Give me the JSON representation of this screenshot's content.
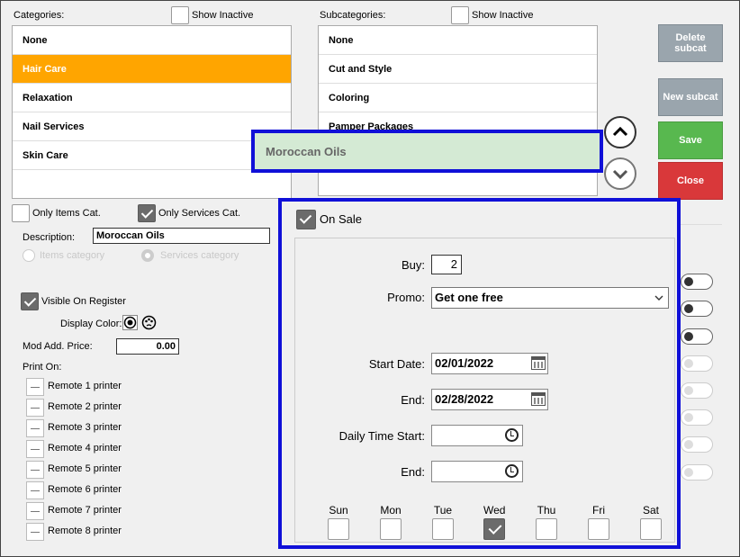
{
  "categories": {
    "header": "Categories:",
    "show_inactive": "Show Inactive",
    "items": [
      {
        "label": "None",
        "selected": false
      },
      {
        "label": "Hair Care",
        "selected": true
      },
      {
        "label": "Relaxation",
        "selected": false
      },
      {
        "label": "Nail Services",
        "selected": false
      },
      {
        "label": "Skin Care",
        "selected": false
      }
    ]
  },
  "subcategories": {
    "header": "Subcategories:",
    "show_inactive": "Show Inactive",
    "items": [
      "None",
      "Cut and Style",
      "Coloring",
      "Pamper Packages"
    ],
    "highlighted": "Moroccan Oils"
  },
  "buttons": {
    "delete_subcat": "Delete subcat",
    "new_subcat": "New subcat",
    "save": "Save",
    "close": "Close"
  },
  "filters": {
    "only_items": "Only Items Cat.",
    "only_services": "Only Services Cat."
  },
  "form": {
    "description_label": "Description:",
    "description_value": "Moroccan Oils",
    "items_category": "Items category",
    "services_category": "Services category",
    "visible_on_register": "Visible On Register",
    "display_color": "Display Color:",
    "mod_add_price_label": "Mod Add. Price:",
    "mod_add_price_value": "0.00",
    "print_on": "Print On:",
    "printers": [
      "Remote 1 printer",
      "Remote 2 printer",
      "Remote 3 printer",
      "Remote 4 printer",
      "Remote 5 printer",
      "Remote 6 printer",
      "Remote 7 printer",
      "Remote 8 printer"
    ]
  },
  "sale": {
    "on_sale": "On Sale",
    "buy_label": "Buy:",
    "buy_value": "2",
    "promo_label": "Promo:",
    "promo_value": "Get one free",
    "start_date_label": "Start Date:",
    "start_date_value": "02/01/2022",
    "end_label": "End:",
    "end_date_value": "02/28/2022",
    "daily_time_start_label": "Daily Time Start:",
    "daily_end_label": "End:",
    "days": [
      {
        "label": "Sun",
        "checked": false
      },
      {
        "label": "Mon",
        "checked": false
      },
      {
        "label": "Tue",
        "checked": false
      },
      {
        "label": "Wed",
        "checked": true
      },
      {
        "label": "Thu",
        "checked": false
      },
      {
        "label": "Fri",
        "checked": false
      },
      {
        "label": "Sat",
        "checked": false
      }
    ]
  },
  "colors": {
    "selected": "#ffa500",
    "highlight_border": "#1010d8",
    "save": "#58b84f",
    "close": "#d9383a"
  }
}
